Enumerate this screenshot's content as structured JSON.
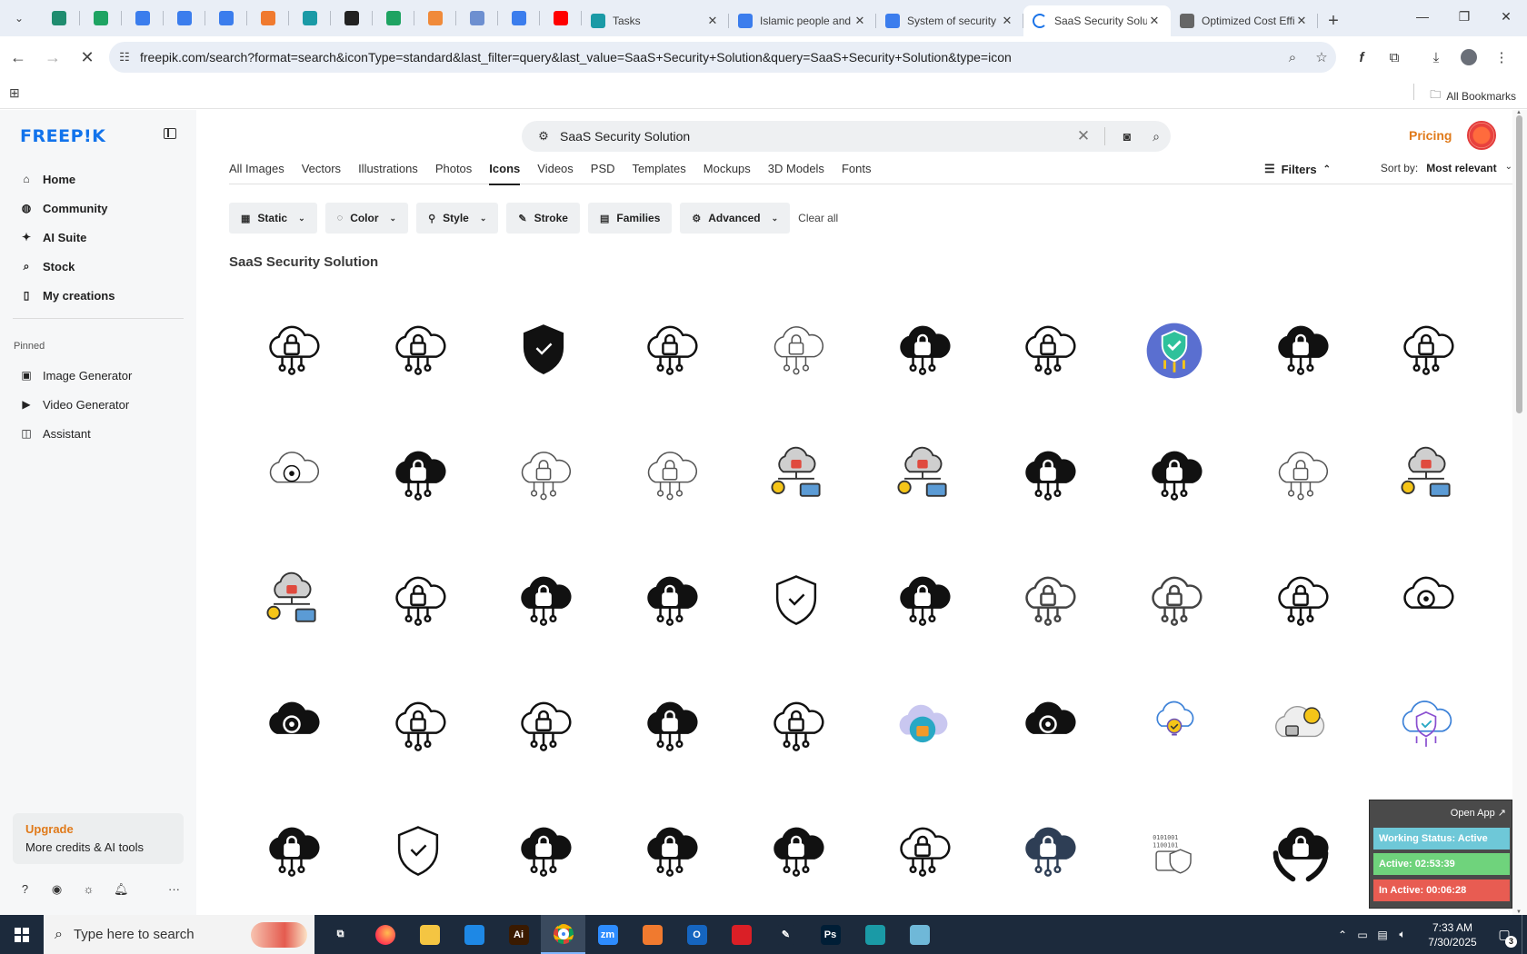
{
  "browser": {
    "pinned_tabs": [
      {
        "icon": "chatgpt-icon",
        "color": "#1f8c6f"
      },
      {
        "icon": "sheets-icon",
        "color": "#1ea362"
      },
      {
        "icon": "docs-icon",
        "color": "#3b7ded"
      },
      {
        "icon": "docs-icon",
        "color": "#3b7ded"
      },
      {
        "icon": "docs-icon",
        "color": "#3b7ded"
      },
      {
        "icon": "xampp-icon",
        "color": "#f07a2f"
      },
      {
        "icon": "app-icon",
        "color": "#1a9aa6"
      },
      {
        "icon": "chatgpt-icon",
        "color": "#222222"
      },
      {
        "icon": "sheets-icon",
        "color": "#1ea362"
      },
      {
        "icon": "flame-icon",
        "color": "#f08a3a"
      },
      {
        "icon": "grid-icon",
        "color": "#6d8fd0"
      },
      {
        "icon": "forms-icon",
        "color": "#3b7ded"
      },
      {
        "icon": "youtube-icon",
        "color": "#ff0000"
      }
    ],
    "tabs": [
      {
        "label": "Tasks",
        "icon": "tasks-icon",
        "color": "#1a9aa6",
        "active": false
      },
      {
        "label": "Islamic people and",
        "icon": "docs-icon",
        "color": "#3b7ded",
        "active": false
      },
      {
        "label": "System of security",
        "icon": "docs-icon",
        "color": "#3b7ded",
        "active": false
      },
      {
        "label": "SaaS Security Solu",
        "icon": "loading-icon",
        "color": "#1a73e8",
        "active": true
      },
      {
        "label": "Optimized Cost Effi",
        "icon": "globe-icon",
        "color": "#666666",
        "active": false
      }
    ],
    "url": "freepik.com/search?format=search&iconType=standard&last_filter=query&last_value=SaaS+Security+Solution&query=SaaS+Security+Solution&type=icon",
    "all_bookmarks": "All Bookmarks"
  },
  "sidebar": {
    "logo": "FREEP!K",
    "nav": [
      {
        "label": "Home",
        "icon": "home-icon"
      },
      {
        "label": "Community",
        "icon": "globe-icon"
      },
      {
        "label": "AI Suite",
        "icon": "sparkle-icon"
      },
      {
        "label": "Stock",
        "icon": "search-icon"
      },
      {
        "label": "My creations",
        "icon": "bookmark-icon"
      }
    ],
    "pinned_label": "Pinned",
    "pinned": [
      {
        "label": "Image Generator",
        "icon": "image-icon"
      },
      {
        "label": "Video Generator",
        "icon": "video-icon"
      },
      {
        "label": "Assistant",
        "icon": "assistant-icon"
      }
    ],
    "upgrade_title": "Upgrade",
    "upgrade_sub": "More credits & AI tools"
  },
  "search": {
    "query": "SaaS Security Solution",
    "pricing": "Pricing"
  },
  "type_tabs": [
    "All Images",
    "Vectors",
    "Illustrations",
    "Photos",
    "Icons",
    "Videos",
    "PSD",
    "Templates",
    "Mockups",
    "3D Models",
    "Fonts"
  ],
  "active_type_tab": "Icons",
  "filters_label": "Filters",
  "sort_label": "Sort by:",
  "sort_value": "Most relevant",
  "chips": [
    {
      "label": "Static",
      "icon": "static-icon",
      "dropdown": true
    },
    {
      "label": "Color",
      "icon": "palette-icon",
      "dropdown": true
    },
    {
      "label": "Style",
      "icon": "brush-icon",
      "dropdown": true
    },
    {
      "label": "Stroke",
      "icon": "pen-icon",
      "dropdown": false
    },
    {
      "label": "Families",
      "icon": "families-icon",
      "dropdown": false
    },
    {
      "label": "Advanced",
      "icon": "gear-icon",
      "dropdown": true
    }
  ],
  "clear_all": "Clear all",
  "results_title": "SaaS Security Solution",
  "icons": [
    {
      "name": "cloud-shield-network",
      "style": "outline"
    },
    {
      "name": "cloud-lock-printer",
      "style": "outline"
    },
    {
      "name": "shield-check-network",
      "style": "solid"
    },
    {
      "name": "cloud-keyhole-network",
      "style": "outline"
    },
    {
      "name": "cloud-check-small",
      "style": "outline-light"
    },
    {
      "name": "cloud-lock-check",
      "style": "solid"
    },
    {
      "name": "cloud-lock-share",
      "style": "outline"
    },
    {
      "name": "shield-circle-color",
      "style": "color"
    },
    {
      "name": "cloud-lock-people",
      "style": "solid"
    },
    {
      "name": "cloud-lock-check-network",
      "style": "outline"
    },
    {
      "name": "cloud-gear-lock",
      "style": "outline-light"
    },
    {
      "name": "cloud-lock-network",
      "style": "solid"
    },
    {
      "name": "cloud-shield-keyhole",
      "style": "outline-light"
    },
    {
      "name": "cloud-keyhole-circle",
      "style": "outline-light"
    },
    {
      "name": "cloud-lock-printer-color",
      "style": "color"
    },
    {
      "name": "cloud-lock-printer-color",
      "style": "color"
    },
    {
      "name": "cloud-lock-check-split",
      "style": "solid"
    },
    {
      "name": "cloud-shield-network",
      "style": "solid"
    },
    {
      "name": "cloud-keyhole-frame",
      "style": "outline-light"
    },
    {
      "name": "cloud-lock-printer-color",
      "style": "color"
    },
    {
      "name": "cloud-lock-printer-color",
      "style": "color"
    },
    {
      "name": "cloud-lock-share",
      "style": "outline"
    },
    {
      "name": "cloud-lock-printer",
      "style": "solid"
    },
    {
      "name": "cloud-network-devices",
      "style": "solid"
    },
    {
      "name": "shield-cloud-check",
      "style": "outline"
    },
    {
      "name": "cloud-shield-network",
      "style": "solid"
    },
    {
      "name": "cloud-lock-printer",
      "style": "outline-grey"
    },
    {
      "name": "cloud-lock-printer",
      "style": "outline-grey"
    },
    {
      "name": "cloud-shield-network",
      "style": "outline"
    },
    {
      "name": "cloud-gear-shield-lock",
      "style": "outline"
    },
    {
      "name": "cloud-gear-lock",
      "style": "solid"
    },
    {
      "name": "cloud-check-network",
      "style": "outline"
    },
    {
      "name": "cloud-lock-hanging",
      "style": "outline"
    },
    {
      "name": "cloud-lock-network",
      "style": "solid"
    },
    {
      "name": "cloud-lock-hanging",
      "style": "outline"
    },
    {
      "name": "cloud-gear-color",
      "style": "color"
    },
    {
      "name": "cloud-gear-lock",
      "style": "solid"
    },
    {
      "name": "cloud-bulb-check",
      "style": "color-light"
    },
    {
      "name": "cloud-gear-lock-color",
      "style": "color"
    },
    {
      "name": "cloud-shield-network-color",
      "style": "color-light"
    },
    {
      "name": "cloud-check-network",
      "style": "solid"
    },
    {
      "name": "shield-cloud-network",
      "style": "outline"
    },
    {
      "name": "cloud-lock-dots",
      "style": "solid"
    },
    {
      "name": "cloud-lock-circuit",
      "style": "solid"
    },
    {
      "name": "cloud-keyhole",
      "style": "solid"
    },
    {
      "name": "cloud-lock-hanging-check",
      "style": "outline"
    },
    {
      "name": "cloud-check-network",
      "style": "solid-grey"
    },
    {
      "name": "binary-lock",
      "style": "outline-light"
    },
    {
      "name": "hands-cloud-lock",
      "style": "solid"
    },
    {
      "name": "cloud-lock-hex",
      "style": "outline"
    }
  ],
  "tracker": {
    "open_app": "Open App ↗",
    "working_status": "Working Status: Active",
    "active_time": "Active: 02:53:39",
    "inactive_time": "In Active: 00:06:28"
  },
  "taskbar": {
    "search_placeholder": "Type here to search",
    "apps": [
      {
        "icon": "task-view-icon",
        "color": "#1c2a3c",
        "label": "⧉"
      },
      {
        "icon": "firefox-icon",
        "color": "#ff7139",
        "label": ""
      },
      {
        "icon": "file-explorer-icon",
        "color": "#f4c542",
        "label": ""
      },
      {
        "icon": "vscode-icon",
        "color": "#1e88e5",
        "label": ""
      },
      {
        "icon": "illustrator-icon",
        "color": "#3a1a00",
        "label": "Ai"
      },
      {
        "icon": "chrome-icon",
        "color": "#3a7d2c",
        "label": ""
      },
      {
        "icon": "zoom-icon",
        "color": "#2d8cff",
        "label": "zm"
      },
      {
        "icon": "xampp-icon",
        "color": "#f07a2f",
        "label": ""
      },
      {
        "icon": "outlook-icon",
        "color": "#1565c0",
        "label": "O"
      },
      {
        "icon": "creative-cloud-icon",
        "color": "#da1f26",
        "label": ""
      },
      {
        "icon": "pen-tool-icon",
        "color": "#1c2a3c",
        "label": "✎"
      },
      {
        "icon": "photoshop-icon",
        "color": "#001e36",
        "label": "Ps"
      },
      {
        "icon": "app-icon",
        "color": "#1a9aa6",
        "label": ""
      },
      {
        "icon": "notepad-icon",
        "color": "#6fb8d8",
        "label": ""
      }
    ],
    "active_app": 5,
    "time": "7:33 AM",
    "date": "7/30/2025",
    "notifications": "3"
  }
}
